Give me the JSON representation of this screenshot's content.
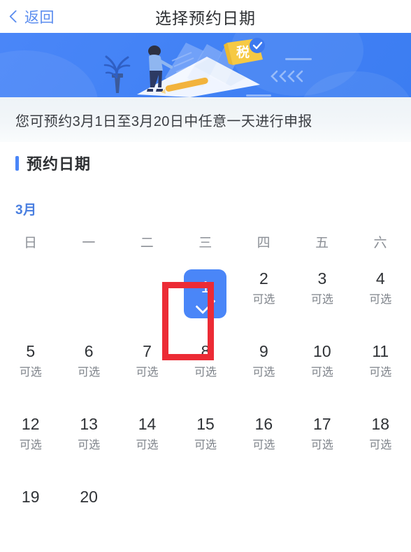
{
  "header": {
    "back_label": "返回",
    "back_icon": "chevron-left-icon",
    "title": "选择预约日期"
  },
  "banner": {
    "badge_text": "税",
    "decoration": "<<<<",
    "background_color": "#4a86f8"
  },
  "notice": {
    "text": "您可预约3月1日至3月20日中任意一天进行申报"
  },
  "section": {
    "title": "预约日期",
    "accent_color": "#4a86f8"
  },
  "calendar": {
    "month_label": "3月",
    "month_color": "#4a7fe0",
    "weekdays": [
      "日",
      "一",
      "二",
      "三",
      "四",
      "五",
      "六"
    ],
    "available_label": "可选",
    "selected_day": "1",
    "selected_color": "#4a86f8",
    "selected_icon": "check-icon",
    "leading_blanks": 3,
    "days": [
      {
        "num": "1",
        "tag": "",
        "selected": true
      },
      {
        "num": "2",
        "tag": "可选",
        "selected": false
      },
      {
        "num": "3",
        "tag": "可选",
        "selected": false
      },
      {
        "num": "4",
        "tag": "可选",
        "selected": false
      },
      {
        "num": "5",
        "tag": "可选",
        "selected": false
      },
      {
        "num": "6",
        "tag": "可选",
        "selected": false
      },
      {
        "num": "7",
        "tag": "可选",
        "selected": false
      },
      {
        "num": "8",
        "tag": "可选",
        "selected": false
      },
      {
        "num": "9",
        "tag": "可选",
        "selected": false
      },
      {
        "num": "10",
        "tag": "可选",
        "selected": false
      },
      {
        "num": "11",
        "tag": "可选",
        "selected": false
      },
      {
        "num": "12",
        "tag": "可选",
        "selected": false
      },
      {
        "num": "13",
        "tag": "可选",
        "selected": false
      },
      {
        "num": "14",
        "tag": "可选",
        "selected": false
      },
      {
        "num": "15",
        "tag": "可选",
        "selected": false
      },
      {
        "num": "16",
        "tag": "可选",
        "selected": false
      },
      {
        "num": "17",
        "tag": "可选",
        "selected": false
      },
      {
        "num": "18",
        "tag": "可选",
        "selected": false
      },
      {
        "num": "19",
        "tag": "",
        "selected": false
      },
      {
        "num": "20",
        "tag": "",
        "selected": false
      }
    ]
  },
  "annotation": {
    "color": "#ec2b35",
    "targets_day": "1"
  }
}
